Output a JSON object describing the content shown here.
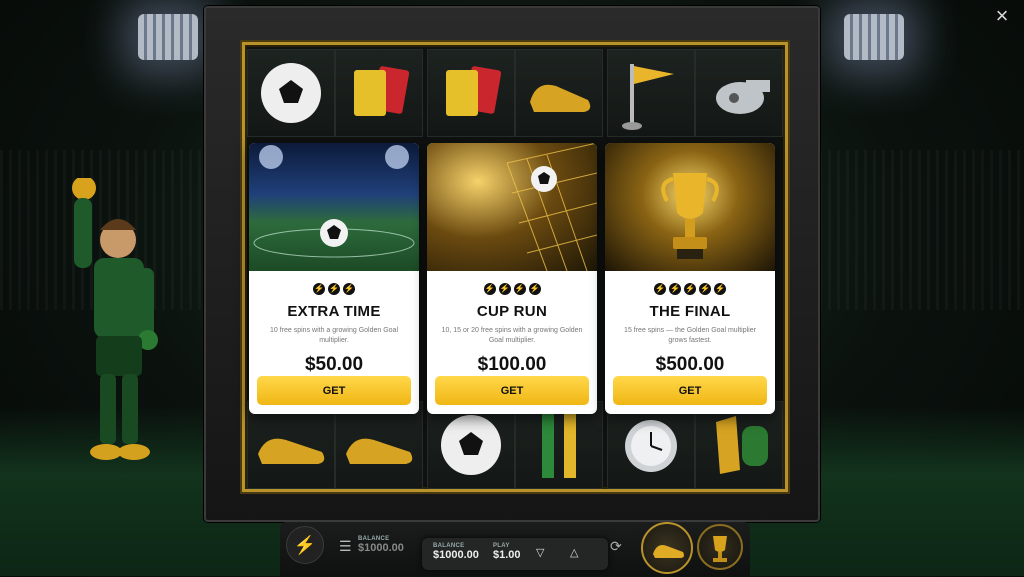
{
  "close_label": "×",
  "offers": [
    {
      "title": "EXTRA TIME",
      "stars": 3,
      "description": "10 free spins with a growing Golden Goal multiplier.",
      "price": "$50.00",
      "button": "GET"
    },
    {
      "title": "CUP RUN",
      "stars": 4,
      "description": "10, 15 or 20 free spins with a growing Golden Goal multiplier.",
      "price": "$100.00",
      "button": "GET"
    },
    {
      "title": "THE FINAL",
      "stars": 5,
      "description": "15 free spins — the Golden Goal multiplier grows fastest.",
      "price": "$500.00",
      "button": "GET"
    }
  ],
  "bottom_bar": {
    "balance_label": "BALANCE",
    "balance_value": "$1000.00",
    "popup": {
      "balance_label": "BALANCE",
      "balance_value": "$1000.00",
      "play_label": "PLAY",
      "play_value": "$1.00"
    }
  },
  "icons": {
    "lightning": "lightning-icon",
    "menu": "menu-icon",
    "autoplay": "autoplay-icon",
    "spin": "golden-boot-icon",
    "bonus": "trophy-icon"
  },
  "colors": {
    "accent_gold": "#f0b614",
    "frame_gold": "#b8932c",
    "card_bg": "#ffffff"
  }
}
